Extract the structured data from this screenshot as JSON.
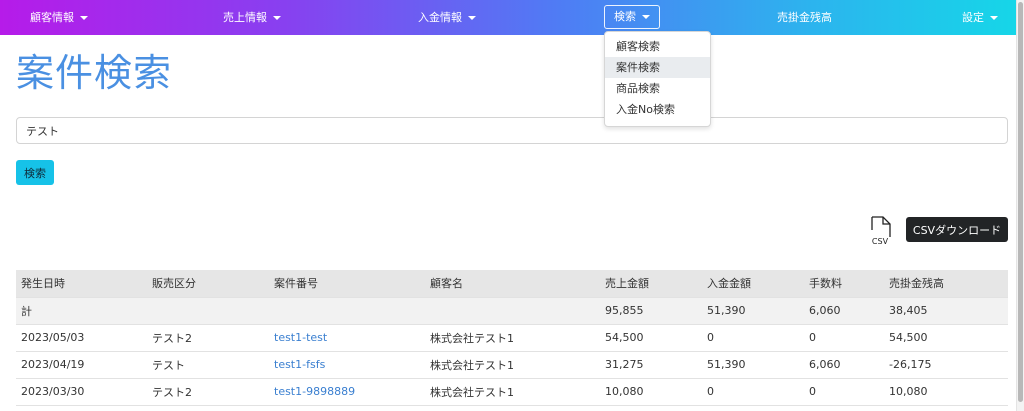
{
  "navbar": {
    "items": [
      {
        "label": "顧客情報",
        "has_caret": true
      },
      {
        "label": "売上情報",
        "has_caret": true
      },
      {
        "label": "入金情報",
        "has_caret": true
      },
      {
        "label": "検索",
        "has_caret": true,
        "active": true
      },
      {
        "label": "売掛金残高",
        "has_caret": false
      },
      {
        "label": "設定",
        "has_caret": true
      }
    ],
    "gradient_colors": [
      "#b61be9",
      "#8840f0",
      "#4f7cf4",
      "#2cb4ee",
      "#16d6e8"
    ]
  },
  "search_dropdown": {
    "items": [
      "顧客検索",
      "案件検索",
      "商品検索",
      "入金No検索"
    ],
    "hovered": "案件検索"
  },
  "page": {
    "title": "案件検索",
    "title_color": "#4a90e2"
  },
  "search": {
    "value": "テスト",
    "button_label": "検索",
    "button_color": "#16c2e8"
  },
  "csv": {
    "icon_text": "CSV",
    "icon": "csv-file-icon",
    "button_label": "CSVダウンロード"
  },
  "table": {
    "headers": [
      "発生日時",
      "販売区分",
      "案件番号",
      "顧客名",
      "売上金額",
      "入金金額",
      "手数料",
      "売掛金残高"
    ],
    "total": {
      "label": "計",
      "sales": "95,855",
      "payment": "51,390",
      "fee": "6,060",
      "balance": "38,405"
    },
    "rows": [
      {
        "date": "2023/05/03",
        "category": "テスト2",
        "case_no": "test1-test",
        "customer": "株式会社テスト1",
        "sales": "54,500",
        "payment": "0",
        "fee": "0",
        "balance": "54,500"
      },
      {
        "date": "2023/04/19",
        "category": "テスト",
        "case_no": "test1-fsfs",
        "customer": "株式会社テスト1",
        "sales": "31,275",
        "payment": "51,390",
        "fee": "6,060",
        "balance": "-26,175"
      },
      {
        "date": "2023/03/30",
        "category": "テスト2",
        "case_no": "test1-9898889",
        "customer": "株式会社テスト1",
        "sales": "10,080",
        "payment": "0",
        "fee": "0",
        "balance": "10,080"
      }
    ]
  }
}
